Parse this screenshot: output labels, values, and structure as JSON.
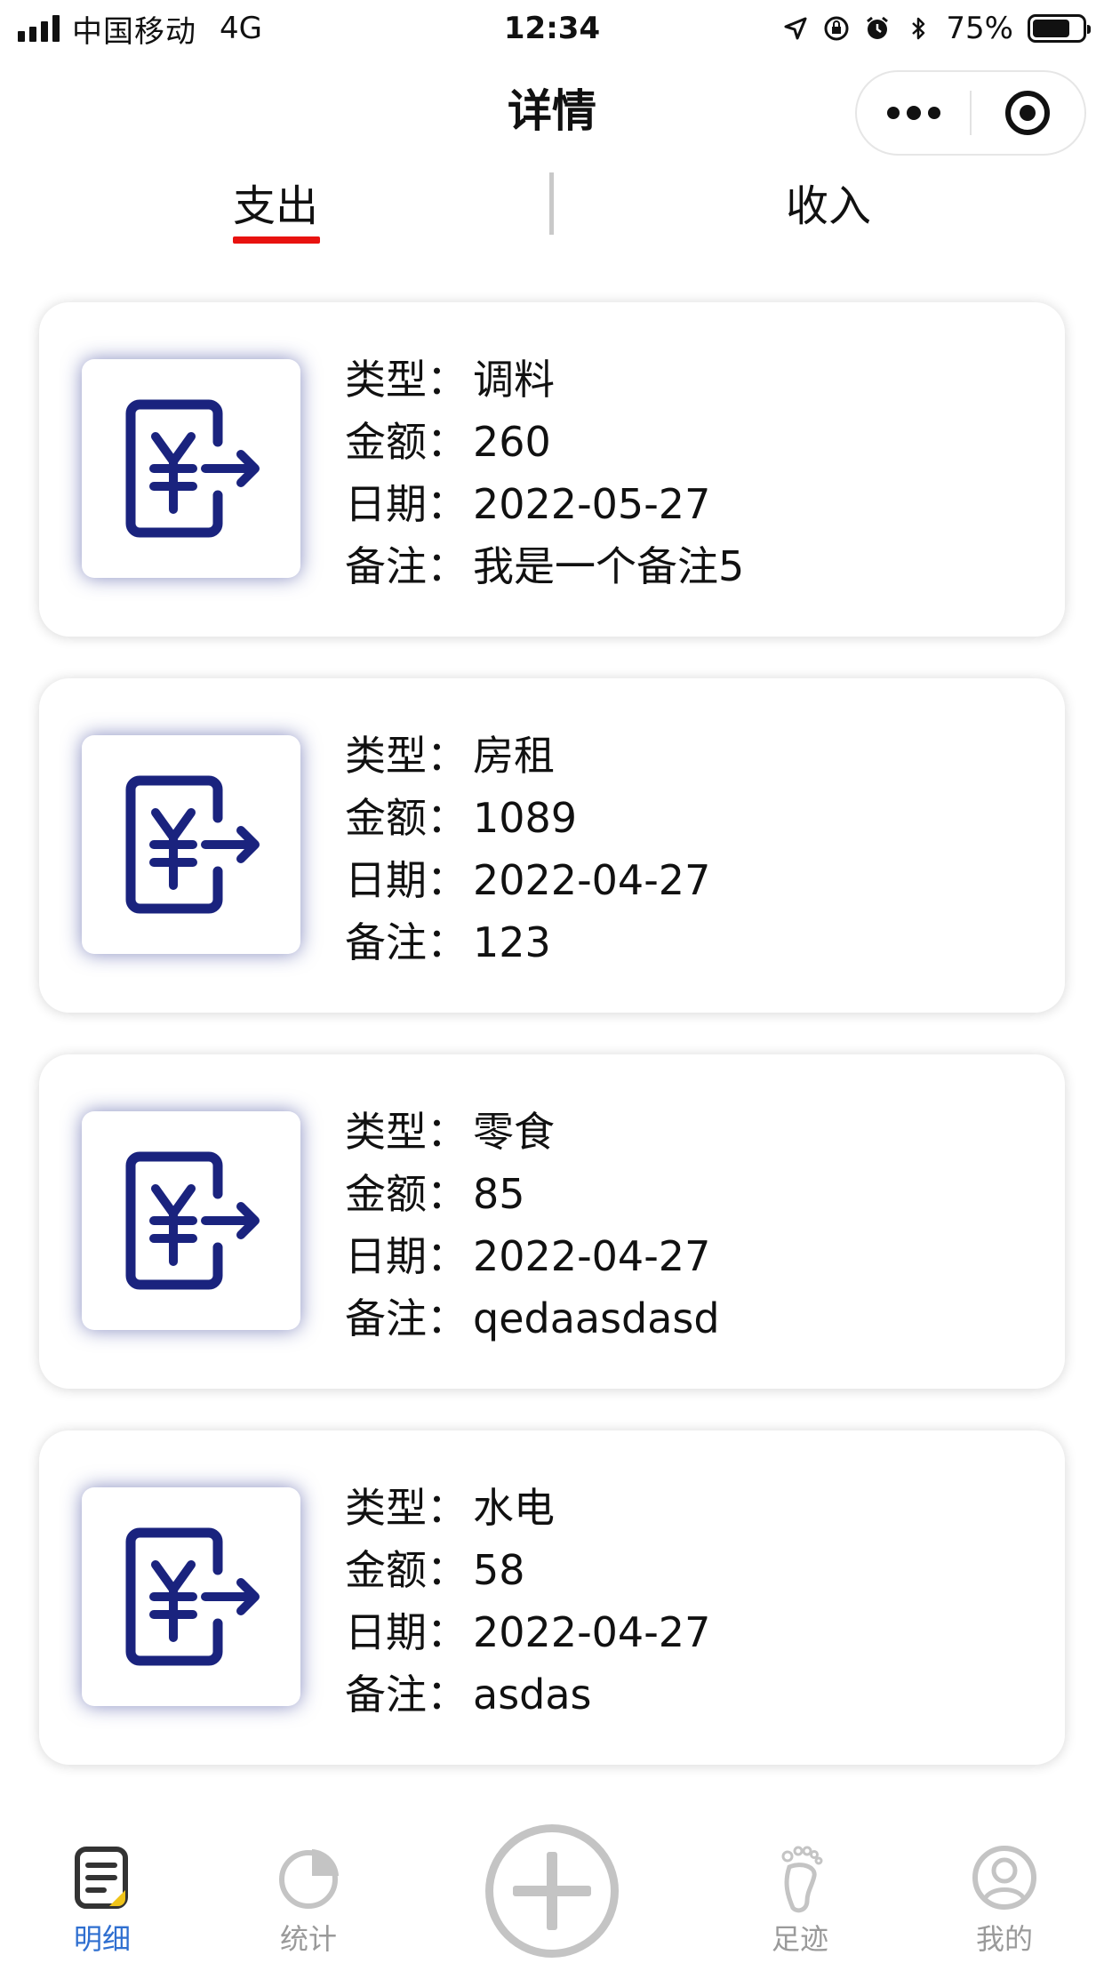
{
  "status_bar": {
    "carrier": "中国移动",
    "network": "4G",
    "time": "12:34",
    "battery_percent": "75%",
    "battery_level": 0.75
  },
  "nav": {
    "title": "详情"
  },
  "tabs": {
    "expense": "支出",
    "income": "收入",
    "active": "expense"
  },
  "labels": {
    "type": "类型：",
    "amount": "金额：",
    "date": "日期：",
    "note": "备注："
  },
  "records": [
    {
      "type": "调料",
      "amount": "260",
      "date": "2022-05-27",
      "note": "我是一个备注5"
    },
    {
      "type": "房租",
      "amount": "1089",
      "date": "2022-04-27",
      "note": "123"
    },
    {
      "type": "零食",
      "amount": "85",
      "date": "2022-04-27",
      "note": "qedaasdasd"
    },
    {
      "type": "水电",
      "amount": "58",
      "date": "2022-04-27",
      "note": "asdas"
    }
  ],
  "tabbar": {
    "detail": "明细",
    "stats": "统计",
    "footprint": "足迹",
    "mine": "我的"
  },
  "colors": {
    "accent_red": "#e8120f",
    "icon_navy": "#1a237e",
    "active_blue": "#2f6fd0",
    "inactive_gray": "#9a9a9a"
  },
  "icons": {
    "record_icon": "yuan-expense-icon"
  }
}
